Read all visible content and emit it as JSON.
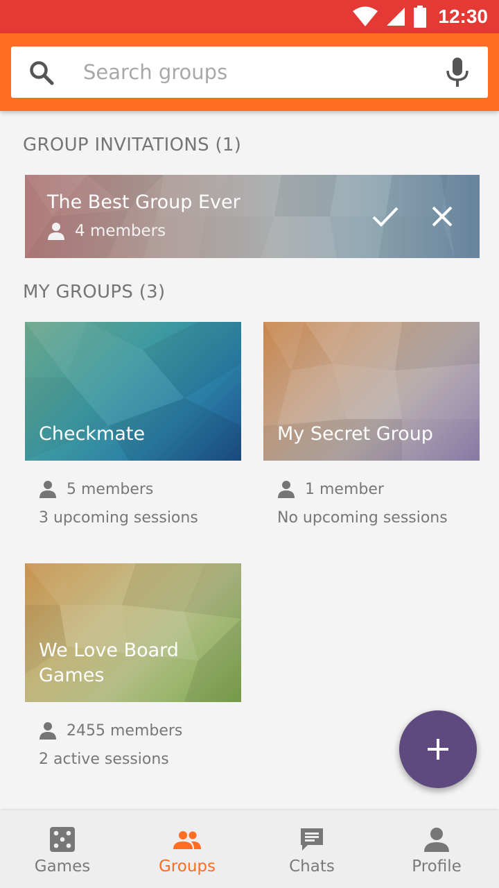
{
  "status_bar": {
    "time": "12:30"
  },
  "search": {
    "placeholder": "Search groups"
  },
  "invitations": {
    "heading": "GROUP INVITATIONS (1)",
    "items": [
      {
        "name": "The Best Group Ever",
        "members": "4 members"
      }
    ]
  },
  "my_groups": {
    "heading": "MY GROUPS (3)",
    "items": [
      {
        "name": "Checkmate",
        "members": "5 members",
        "sessions": "3 upcoming sessions"
      },
      {
        "name": "My Secret Group",
        "members": "1 member",
        "sessions": "No upcoming sessions"
      },
      {
        "name": "We Love Board Games",
        "members": "2455 members",
        "sessions": "2 active sessions"
      }
    ]
  },
  "bottom_nav": {
    "items": [
      {
        "label": "Games",
        "icon": "dice-icon",
        "active": false
      },
      {
        "label": "Groups",
        "icon": "groups-icon",
        "active": true
      },
      {
        "label": "Chats",
        "icon": "chat-icon",
        "active": false
      },
      {
        "label": "Profile",
        "icon": "profile-icon",
        "active": false
      }
    ]
  },
  "colors": {
    "status_bar": "#e53935",
    "app_bar": "#ff6d22",
    "accent": "#ff6d22",
    "fab": "#5e4a7e",
    "nav_background": "#eeeeee"
  }
}
